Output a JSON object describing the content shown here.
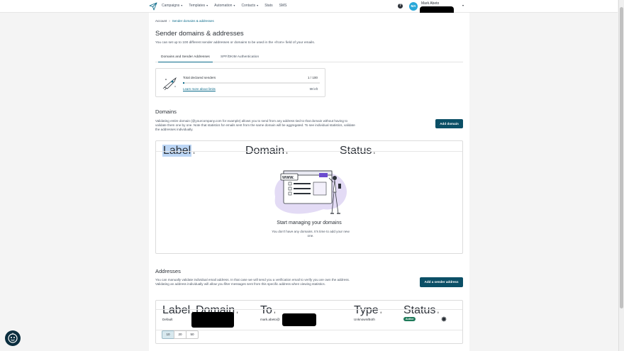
{
  "nav": {
    "items": [
      {
        "label": "Campaigns",
        "dropdown": true
      },
      {
        "label": "Templates",
        "dropdown": true
      },
      {
        "label": "Automation",
        "dropdown": true
      },
      {
        "label": "Contacts",
        "dropdown": true
      },
      {
        "label": "Stats",
        "dropdown": false
      },
      {
        "label": "SMS",
        "dropdown": false
      }
    ],
    "help_icon": "question-circle-icon",
    "avatar_initials": "MA",
    "user_name": "Mark Abeto"
  },
  "breadcrumb": {
    "root": "Account",
    "separator": "›",
    "current": "Sender domains & addresses"
  },
  "page": {
    "title": "Sender domains & addresses",
    "subtitle": "You can set up to 100 different sender addresses or domains to be used in the «from» field of your emails."
  },
  "tabs": [
    {
      "label": "Domains and Sender Addresses",
      "active": true
    },
    {
      "label": "SPF/DKIM Authentication",
      "active": false
    }
  ],
  "senders": {
    "label": "Total declared senders",
    "count": "1 / 100",
    "progress_fraction": 0.01,
    "link": "Learn more about limits",
    "left": "99 left"
  },
  "domains": {
    "title": "Domains",
    "description": "Validating entire domain (@yourcompany.com for example) allows you to send from any address tied to that domain without having to validate them one by one. Note that statistics for emails sent from the same domain will be aggregated. To see individual statistics, validate the addresses individually.",
    "button": "Add domain",
    "columns": [
      "Label",
      "Domain",
      "Status"
    ],
    "empty_illus_text": "WWW.",
    "empty_title": "Start managing your domains",
    "empty_text": "You don't have any domains. It's time to add your new one."
  },
  "addresses": {
    "title": "Addresses",
    "description": "You can manually validate individual email address. In that case we will send you a verification email to verify you are own the address. Validating an address individually will allow you filter messages sent from this specific address when viewing statistics.",
    "button": "Add a sender address",
    "columns": [
      "Label",
      "Domain",
      "To",
      "Type",
      "Status"
    ],
    "rows": [
      {
        "label": "Default",
        "to": "mark.abeto@",
        "type": "Unknown/Both",
        "status": "Active"
      }
    ]
  },
  "pagination": {
    "sizes": [
      "10",
      "20",
      "50"
    ],
    "active": "10"
  },
  "colors": {
    "accent": "#0b6b8a",
    "button": "#0b4f66",
    "active_badge": "#1f7a5a",
    "avatar": "#29a8d9"
  }
}
